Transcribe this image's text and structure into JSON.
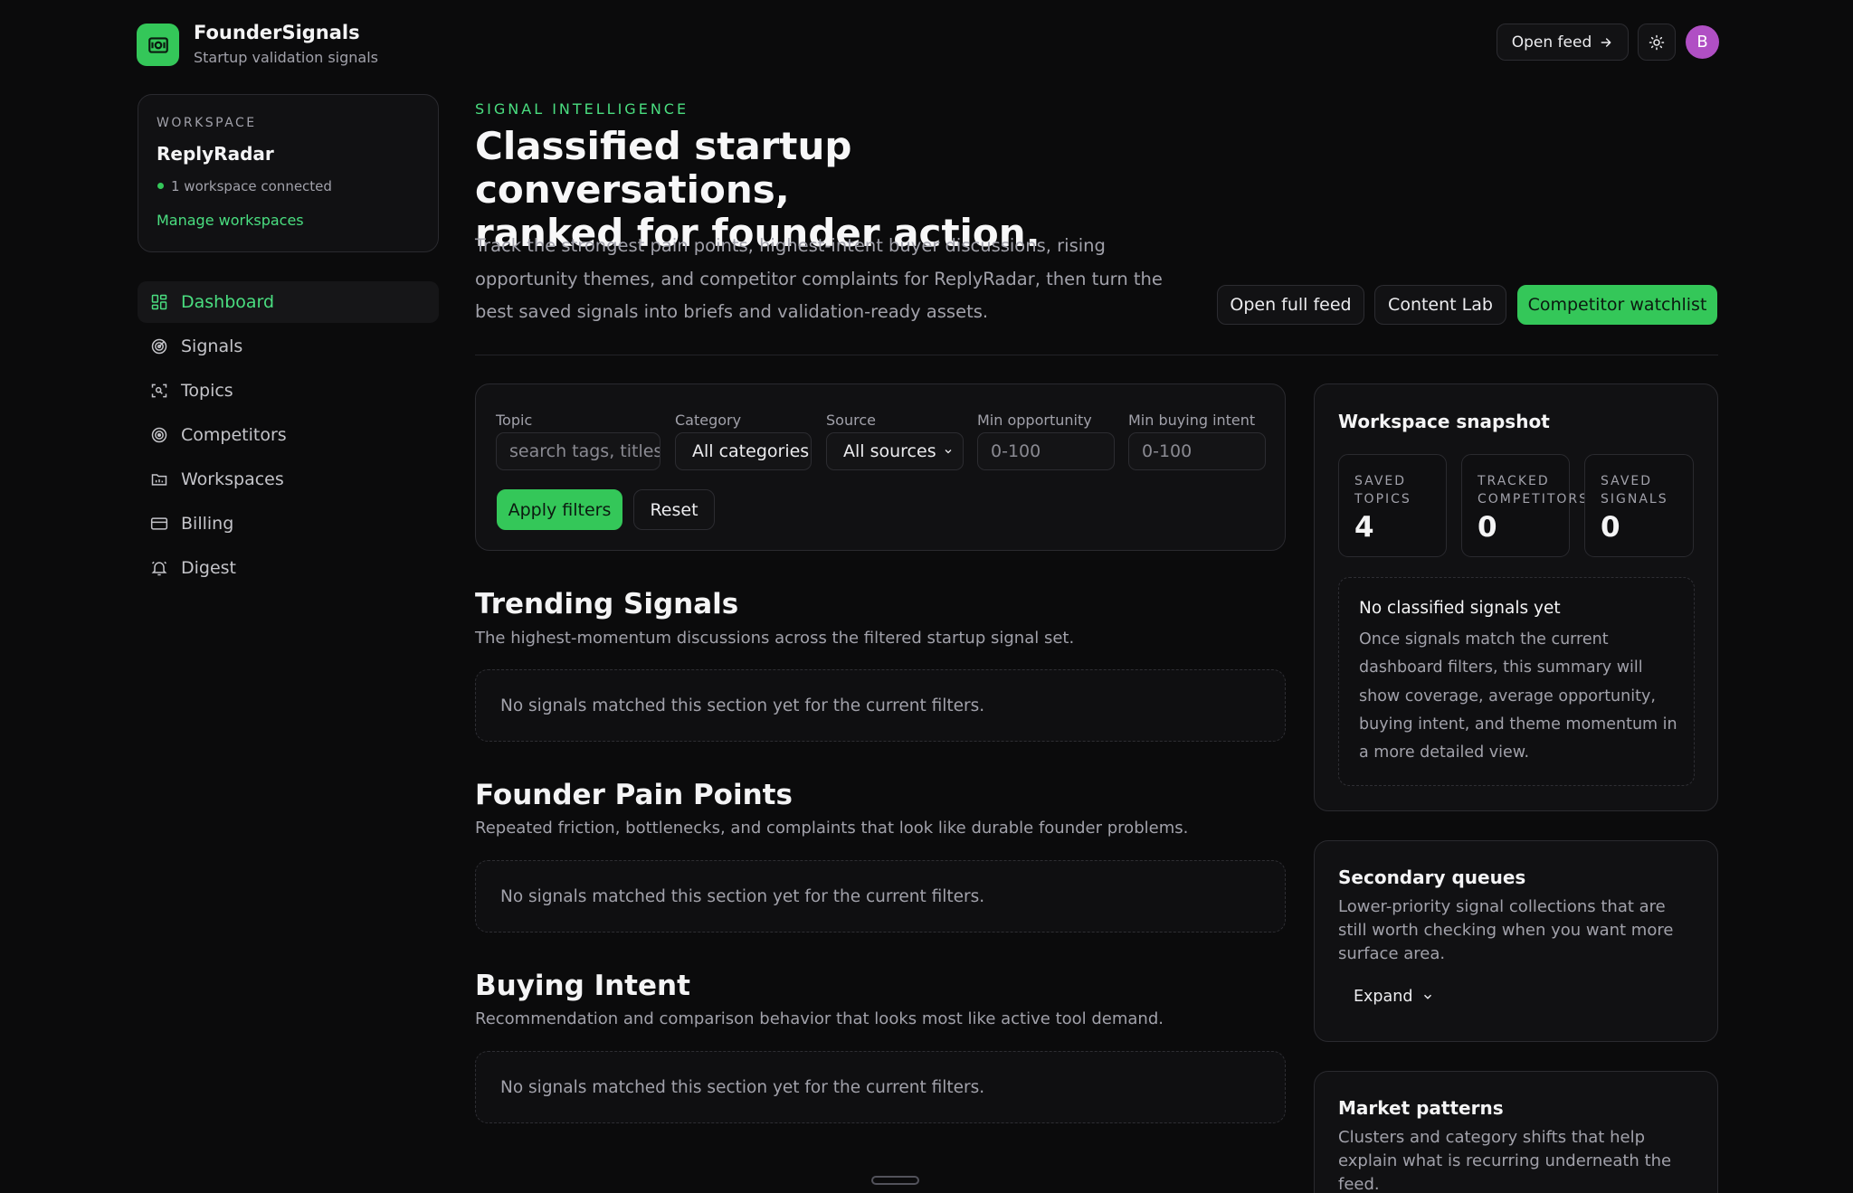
{
  "header": {
    "brand_name": "FounderSignals",
    "brand_sub": "Startup validation signals",
    "open_feed_label": "Open feed",
    "avatar_initial": "B"
  },
  "sidebar": {
    "workspace_label": "WORKSPACE",
    "workspace_name": "ReplyRadar",
    "connected_text": "1 workspace connected",
    "manage_label": "Manage workspaces",
    "items": [
      {
        "label": "Dashboard",
        "icon": "dashboard-icon",
        "active": true
      },
      {
        "label": "Signals",
        "icon": "signals-icon"
      },
      {
        "label": "Topics",
        "icon": "topics-icon"
      },
      {
        "label": "Competitors",
        "icon": "competitors-icon"
      },
      {
        "label": "Workspaces",
        "icon": "workspaces-icon"
      },
      {
        "label": "Billing",
        "icon": "billing-icon"
      },
      {
        "label": "Digest",
        "icon": "digest-icon"
      }
    ]
  },
  "hero": {
    "eyebrow": "SIGNAL INTELLIGENCE",
    "title_line1": "Classified startup conversations,",
    "title_line2": "ranked for founder action.",
    "description": "Track the strongest pain points, highest-intent buyer discussions, rising opportunity themes, and competitor complaints for ReplyRadar, then turn the best saved signals into briefs and validation-ready assets.",
    "buttons": {
      "full_feed": "Open full feed",
      "content_lab": "Content Lab",
      "watchlist": "Competitor watchlist"
    }
  },
  "filters": {
    "topic_label": "Topic",
    "topic_placeholder": "search tags, titles...",
    "category_label": "Category",
    "category_value": "All categories",
    "source_label": "Source",
    "source_value": "All sources",
    "min_opp_label": "Min opportunity",
    "min_opp_placeholder": "0-100",
    "min_intent_label": "Min buying intent",
    "min_intent_placeholder": "0-100",
    "apply_label": "Apply filters",
    "reset_label": "Reset"
  },
  "sections": [
    {
      "title": "Trending Signals",
      "desc": "The highest-momentum discussions across the filtered startup signal set.",
      "empty": "No signals matched this section yet for the current filters."
    },
    {
      "title": "Founder Pain Points",
      "desc": "Repeated friction, bottlenecks, and complaints that look like durable founder problems.",
      "empty": "No signals matched this section yet for the current filters."
    },
    {
      "title": "Buying Intent",
      "desc": "Recommendation and comparison behavior that looks most like active tool demand.",
      "empty": "No signals matched this section yet for the current filters."
    }
  ],
  "snapshot": {
    "title": "Workspace snapshot",
    "stats": [
      {
        "label_line1": "SAVED",
        "label_line2": "TOPICS",
        "value": "4"
      },
      {
        "label_line1": "TRACKED",
        "label_line2": "COMPETITORS",
        "value": "0"
      },
      {
        "label_line1": "SAVED",
        "label_line2": "SIGNALS",
        "value": "0"
      }
    ],
    "empty_title": "No classified signals yet",
    "empty_desc": "Once signals match the current dashboard filters, this summary will show coverage, average opportunity, buying intent, and theme momentum in a more detailed view."
  },
  "secondary": {
    "title": "Secondary queues",
    "desc": "Lower-priority signal collections that are still worth checking when you want more surface area.",
    "expand_label": "Expand"
  },
  "market": {
    "title": "Market patterns",
    "desc": "Clusters and category shifts that help explain what is recurring underneath the feed."
  },
  "colors": {
    "accent": "#34c759",
    "accent_text": "#4ade80",
    "background": "#0b0b0c",
    "avatar": "#b04fc4"
  }
}
